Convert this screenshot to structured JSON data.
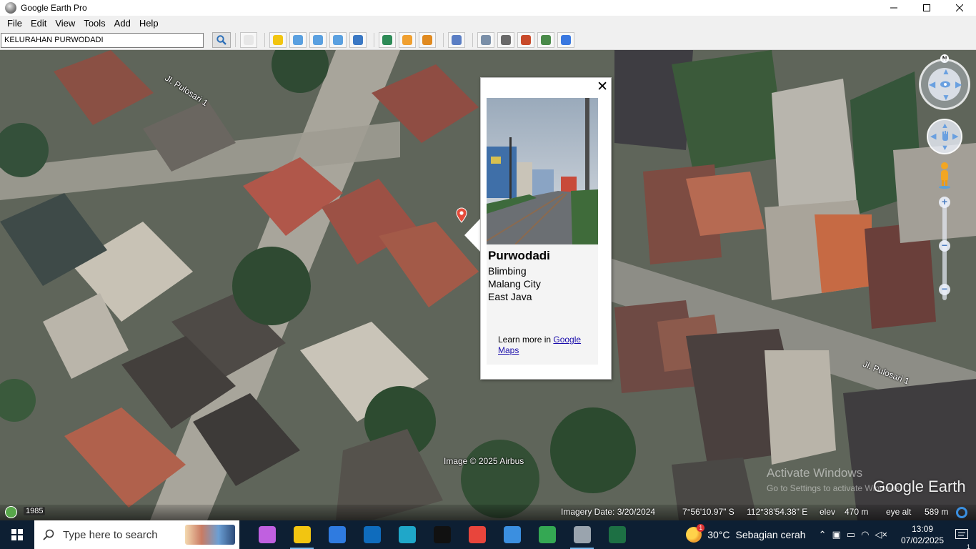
{
  "window": {
    "title": "Google Earth Pro",
    "minimize_icon": "minimize-icon",
    "maximize_icon": "maximize-icon",
    "close_icon": "close-icon"
  },
  "menu": [
    {
      "label": "File"
    },
    {
      "label": "Edit"
    },
    {
      "label": "View"
    },
    {
      "label": "Tools"
    },
    {
      "label": "Add"
    },
    {
      "label": "Help"
    }
  ],
  "search": {
    "value": "KELURAHAN PURWODADI"
  },
  "toolbar_icons": [
    "sidebar-toggle-icon",
    "placemark-icon",
    "polygon-icon",
    "path-icon",
    "overlay-icon",
    "tour-icon",
    "historical-imagery-icon",
    "sunlight-icon",
    "planets-icon",
    "ruler-icon",
    "email-icon",
    "print-icon",
    "save-image-icon",
    "view-in-maps-icon",
    "earth-icon"
  ],
  "toolbar_colors": [
    "#e7e7e7",
    "#f2c511",
    "#5aa0e0",
    "#5aa0e0",
    "#5aa0e0",
    "#3a78c4",
    "#2e8b57",
    "#f0a030",
    "#e08a20",
    "#5a7ec4",
    "#7a8fa8",
    "#6a6a6a",
    "#c84a2a",
    "#4a8a4a",
    "#3a78e0"
  ],
  "map": {
    "road_labels": [
      "Jl. Pulosari 1",
      "Jl. Pulosari 1"
    ],
    "copyright": "Image © 2025 Airbus",
    "watermark_title": "Activate Windows",
    "watermark_sub": "Go to Settings to activate Windows.",
    "logo": "Google Earth",
    "compass_north": "N"
  },
  "balloon": {
    "title": "Purwodadi",
    "lines": [
      "Blimbing",
      "Malang City",
      "East Java"
    ],
    "learn_more_prefix": "Learn more in ",
    "learn_more_link": "Google Maps",
    "close_glyph": "✕"
  },
  "status": {
    "year": "1985",
    "imagery_date": "Imagery Date: 3/20/2024",
    "lat": "7°56'10.97\" S",
    "lon": "112°38'54.38\" E",
    "elev_label": "elev",
    "elev": "470 m",
    "eye_label": "eye alt",
    "eye": "589 m"
  },
  "taskbar": {
    "search_placeholder": "Type here to search",
    "apps": [
      {
        "name": "copilot-icon",
        "color": "#c060e0",
        "active": false
      },
      {
        "name": "file-explorer-icon",
        "color": "#f2c511",
        "active": true
      },
      {
        "name": "store-icon",
        "color": "#2f7be0",
        "active": false
      },
      {
        "name": "outlook-icon",
        "color": "#0f6cbd",
        "active": false
      },
      {
        "name": "edge-icon",
        "color": "#1fa7c9",
        "active": false
      },
      {
        "name": "tiktok-icon",
        "color": "#111111",
        "active": false
      },
      {
        "name": "chrome-icon",
        "color": "#e8453c",
        "active": false
      },
      {
        "name": "photos-icon",
        "color": "#3b8fe0",
        "active": false
      },
      {
        "name": "chrome-profile-icon",
        "color": "#34a853",
        "active": false
      },
      {
        "name": "google-earth-icon",
        "color": "#9aa4ae",
        "active": true
      },
      {
        "name": "excel-icon",
        "color": "#1d7044",
        "active": false
      }
    ],
    "weather_temp": "30°C",
    "weather_desc": "Sebagian cerah",
    "weather_badge": "1",
    "time": "13:09",
    "date": "07/02/2025",
    "notification_count": "1"
  }
}
